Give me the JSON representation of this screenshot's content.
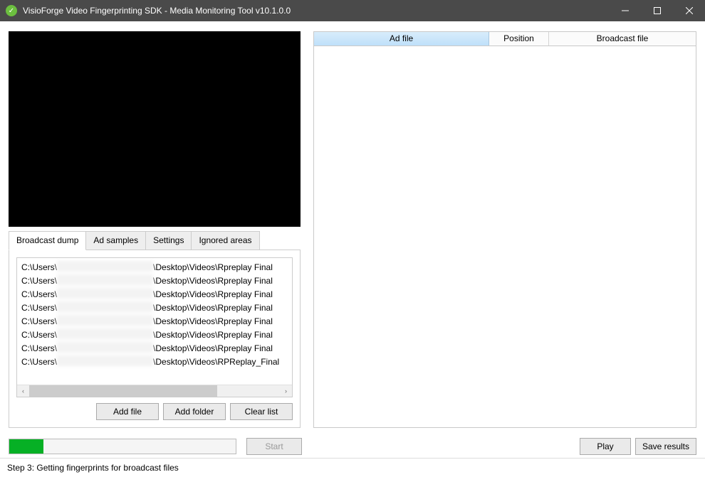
{
  "titlebar": {
    "title": "VisioForge Video Fingerprinting SDK - Media Monitoring Tool v10.1.0.0"
  },
  "tabs": {
    "broadcast_dump": "Broadcast dump",
    "ad_samples": "Ad samples",
    "settings": "Settings",
    "ignored_areas": "Ignored areas"
  },
  "files": {
    "path_prefix": "C:\\Users\\",
    "items": [
      {
        "suffix": "\\Desktop\\Videos\\Rpreplay Final"
      },
      {
        "suffix": "\\Desktop\\Videos\\Rpreplay Final"
      },
      {
        "suffix": "\\Desktop\\Videos\\Rpreplay Final"
      },
      {
        "suffix": "\\Desktop\\Videos\\Rpreplay Final"
      },
      {
        "suffix": "\\Desktop\\Videos\\Rpreplay Final"
      },
      {
        "suffix": "\\Desktop\\Videos\\Rpreplay Final"
      },
      {
        "suffix": "\\Desktop\\Videos\\Rpreplay Final"
      },
      {
        "suffix": "\\Desktop\\Videos\\RPReplay_Final"
      }
    ]
  },
  "buttons": {
    "add_file": "Add file",
    "add_folder": "Add folder",
    "clear_list": "Clear list",
    "start": "Start",
    "play": "Play",
    "save_results": "Save results"
  },
  "table": {
    "col_ad_file": "Ad file",
    "col_position": "Position",
    "col_broadcast_file": "Broadcast file"
  },
  "progress": {
    "percent": 15
  },
  "status": {
    "text": "Step 3: Getting fingerprints for broadcast files"
  }
}
